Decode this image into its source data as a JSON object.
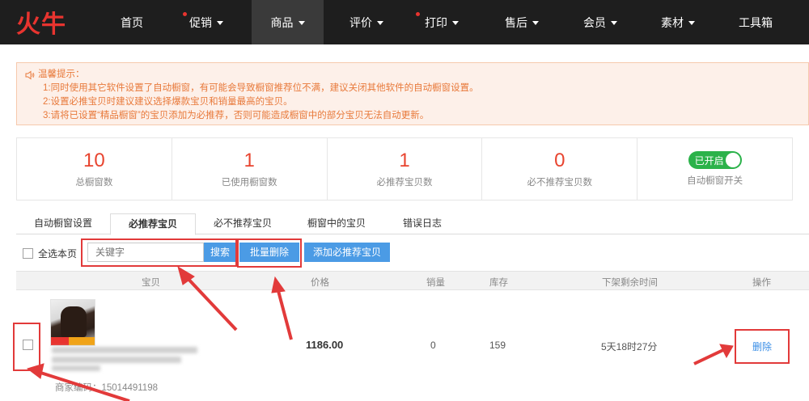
{
  "logo": {
    "text": "火牛"
  },
  "nav": {
    "items": [
      {
        "label": "首页",
        "caret": false,
        "dot": false,
        "active": false
      },
      {
        "label": "促销",
        "caret": true,
        "dot": true,
        "active": false
      },
      {
        "label": "商品",
        "caret": true,
        "dot": false,
        "active": true
      },
      {
        "label": "评价",
        "caret": true,
        "dot": false,
        "active": false
      },
      {
        "label": "打印",
        "caret": true,
        "dot": true,
        "active": false
      },
      {
        "label": "售后",
        "caret": true,
        "dot": false,
        "active": false
      },
      {
        "label": "会员",
        "caret": true,
        "dot": false,
        "active": false
      },
      {
        "label": "素材",
        "caret": true,
        "dot": false,
        "active": false
      },
      {
        "label": "工具箱",
        "caret": false,
        "dot": false,
        "active": false
      }
    ]
  },
  "notice": {
    "title": "温馨提示：",
    "lines": [
      "1:同时使用其它软件设置了自动橱窗，有可能会导致橱窗推荐位不满，建议关闭其他软件的自动橱窗设置。",
      "2:设置必推宝贝时建议建议选择爆款宝贝和销量最高的宝贝。",
      "3:请将已设置“精品橱窗”的宝贝添加为必推荐，否则可能造成橱窗中的部分宝贝无法自动更新。"
    ]
  },
  "stats": [
    {
      "value": "10",
      "label": "总橱窗数"
    },
    {
      "value": "1",
      "label": "已使用橱窗数"
    },
    {
      "value": "1",
      "label": "必推荐宝贝数"
    },
    {
      "value": "0",
      "label": "必不推荐宝贝数"
    }
  ],
  "auto_switch": {
    "state_label": "已开启",
    "label": "自动橱窗开关",
    "on": true
  },
  "tabs": [
    {
      "label": "自动橱窗设置",
      "active": false
    },
    {
      "label": "必推荐宝贝",
      "active": true
    },
    {
      "label": "必不推荐宝贝",
      "active": false
    },
    {
      "label": "橱窗中的宝贝",
      "active": false
    },
    {
      "label": "错误日志",
      "active": false
    }
  ],
  "toolbar": {
    "select_all": "全选本页",
    "search_placeholder": "关键字",
    "search_btn": "搜索",
    "batch_delete": "批量删除",
    "add_btn": "添加必推荐宝贝"
  },
  "table": {
    "headers": [
      "宝贝",
      "价格",
      "销量",
      "库存",
      "下架剩余时间",
      "操作"
    ],
    "rows": [
      {
        "price": "1186.00",
        "sales": "0",
        "stock": "159",
        "remaining": "5天18时27分",
        "action": "删除",
        "merchant_code": "商家编码：15014491198"
      }
    ]
  },
  "colors": {
    "nav_bg": "#1e1e1e",
    "brand_red": "#e8342f",
    "notice_text": "#e8793a",
    "stat_number": "#e8442f",
    "toggle_green": "#2bb24a",
    "button_blue": "#4b9be5",
    "annotation_red": "#e23a3a"
  }
}
